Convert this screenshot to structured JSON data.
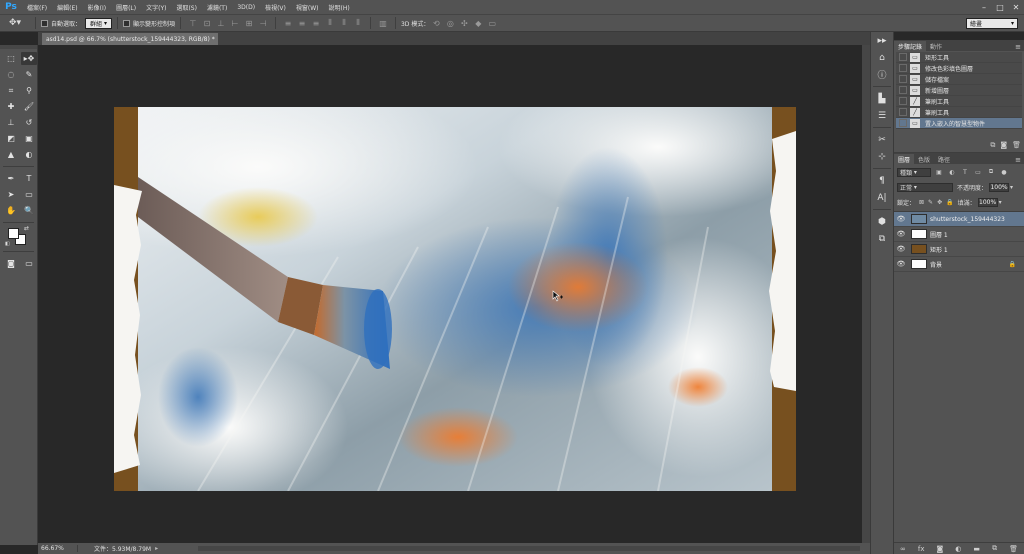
{
  "app": {
    "logo": "Ps",
    "menu": [
      "檔案(F)",
      "編輯(E)",
      "影像(I)",
      "圖層(L)",
      "文字(Y)",
      "選取(S)",
      "濾鏡(T)",
      "3D(D)",
      "檢視(V)",
      "視窗(W)",
      "說明(H)"
    ],
    "window_controls": [
      "–",
      "□",
      "✕"
    ]
  },
  "options_bar": {
    "auto_select_label": "自動選取：",
    "auto_select_value": "群組",
    "show_transform_label": "顯示變形控制項",
    "mode_3d_label": "3D 模式：",
    "workspace": "繪畫"
  },
  "document": {
    "tab_title": "asd14.psd @ 66.7% (shutterstock_159444323, RGB/8) *",
    "tab_close": "×"
  },
  "status": {
    "zoom": "66.67%",
    "doc_size": "文件：5.93M/8.79M",
    "arrow": "▸"
  },
  "history_panel": {
    "tabs": [
      "步驟記錄",
      "動作"
    ],
    "items": [
      {
        "label": "矩形工具"
      },
      {
        "label": "修改色彩填色圖層"
      },
      {
        "label": "儲存檔案"
      },
      {
        "label": "新增圖層"
      },
      {
        "label": "筆刷工具"
      },
      {
        "label": "筆刷工具"
      },
      {
        "label": "置入嵌入的智慧型物件",
        "selected": true
      }
    ]
  },
  "layers_panel": {
    "tabs": [
      "圖層",
      "色版",
      "路徑"
    ],
    "kind_filter": "種類",
    "blend_mode": "正常",
    "opacity_label": "不透明度：",
    "opacity_value": "100%",
    "lock_label": "鎖定：",
    "fill_label": "填滿：",
    "fill_value": "100%",
    "layers": [
      {
        "name": "shutterstock_159444323",
        "selected": true,
        "thumb_color": "#6f8aa3"
      },
      {
        "name": "圖層 1",
        "thumb_color": "#ffffff"
      },
      {
        "name": "矩形 1",
        "thumb_color": "#77501f"
      },
      {
        "name": "背景",
        "thumb_color": "#ffffff",
        "locked": true
      }
    ]
  },
  "colors": {
    "brown_border": "#77501f",
    "selection": "#62778f",
    "ps_blue": "#31a8ff"
  }
}
